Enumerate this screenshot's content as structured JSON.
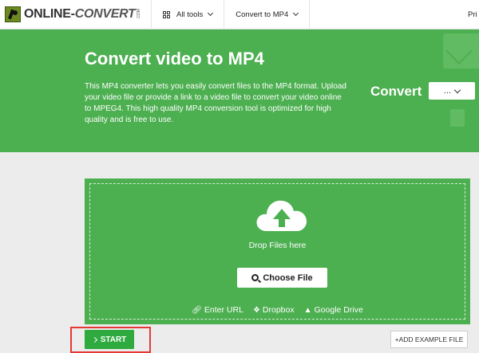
{
  "nav": {
    "logo_text_1": "ONLINE-",
    "logo_text_2": "CONVERT",
    "logo_com": ".COM",
    "all_tools": "All tools",
    "convert_to": "Convert to MP4",
    "right_cut": "Pri"
  },
  "hero": {
    "title": "Convert video to MP4",
    "description": "This MP4 converter lets you easily convert files to the MP4 format. Upload your video file or provide a link to a video file to convert your video online to MPEG4. This high quality MP4 conversion tool is optimized for high quality and is free to use.",
    "convert_label": "Convert",
    "convert_select_value": "..."
  },
  "upload": {
    "drop_text": "Drop Files here",
    "choose_file": "Choose File",
    "enter_url": "Enter URL",
    "dropbox": "Dropbox",
    "google_drive": "Google Drive"
  },
  "actions": {
    "start": "START",
    "add_example": "ADD EXAMPLE FILE"
  },
  "colors": {
    "brand_green": "#4caf50",
    "start_green": "#2eaa3e",
    "highlight_red": "#e53935"
  }
}
